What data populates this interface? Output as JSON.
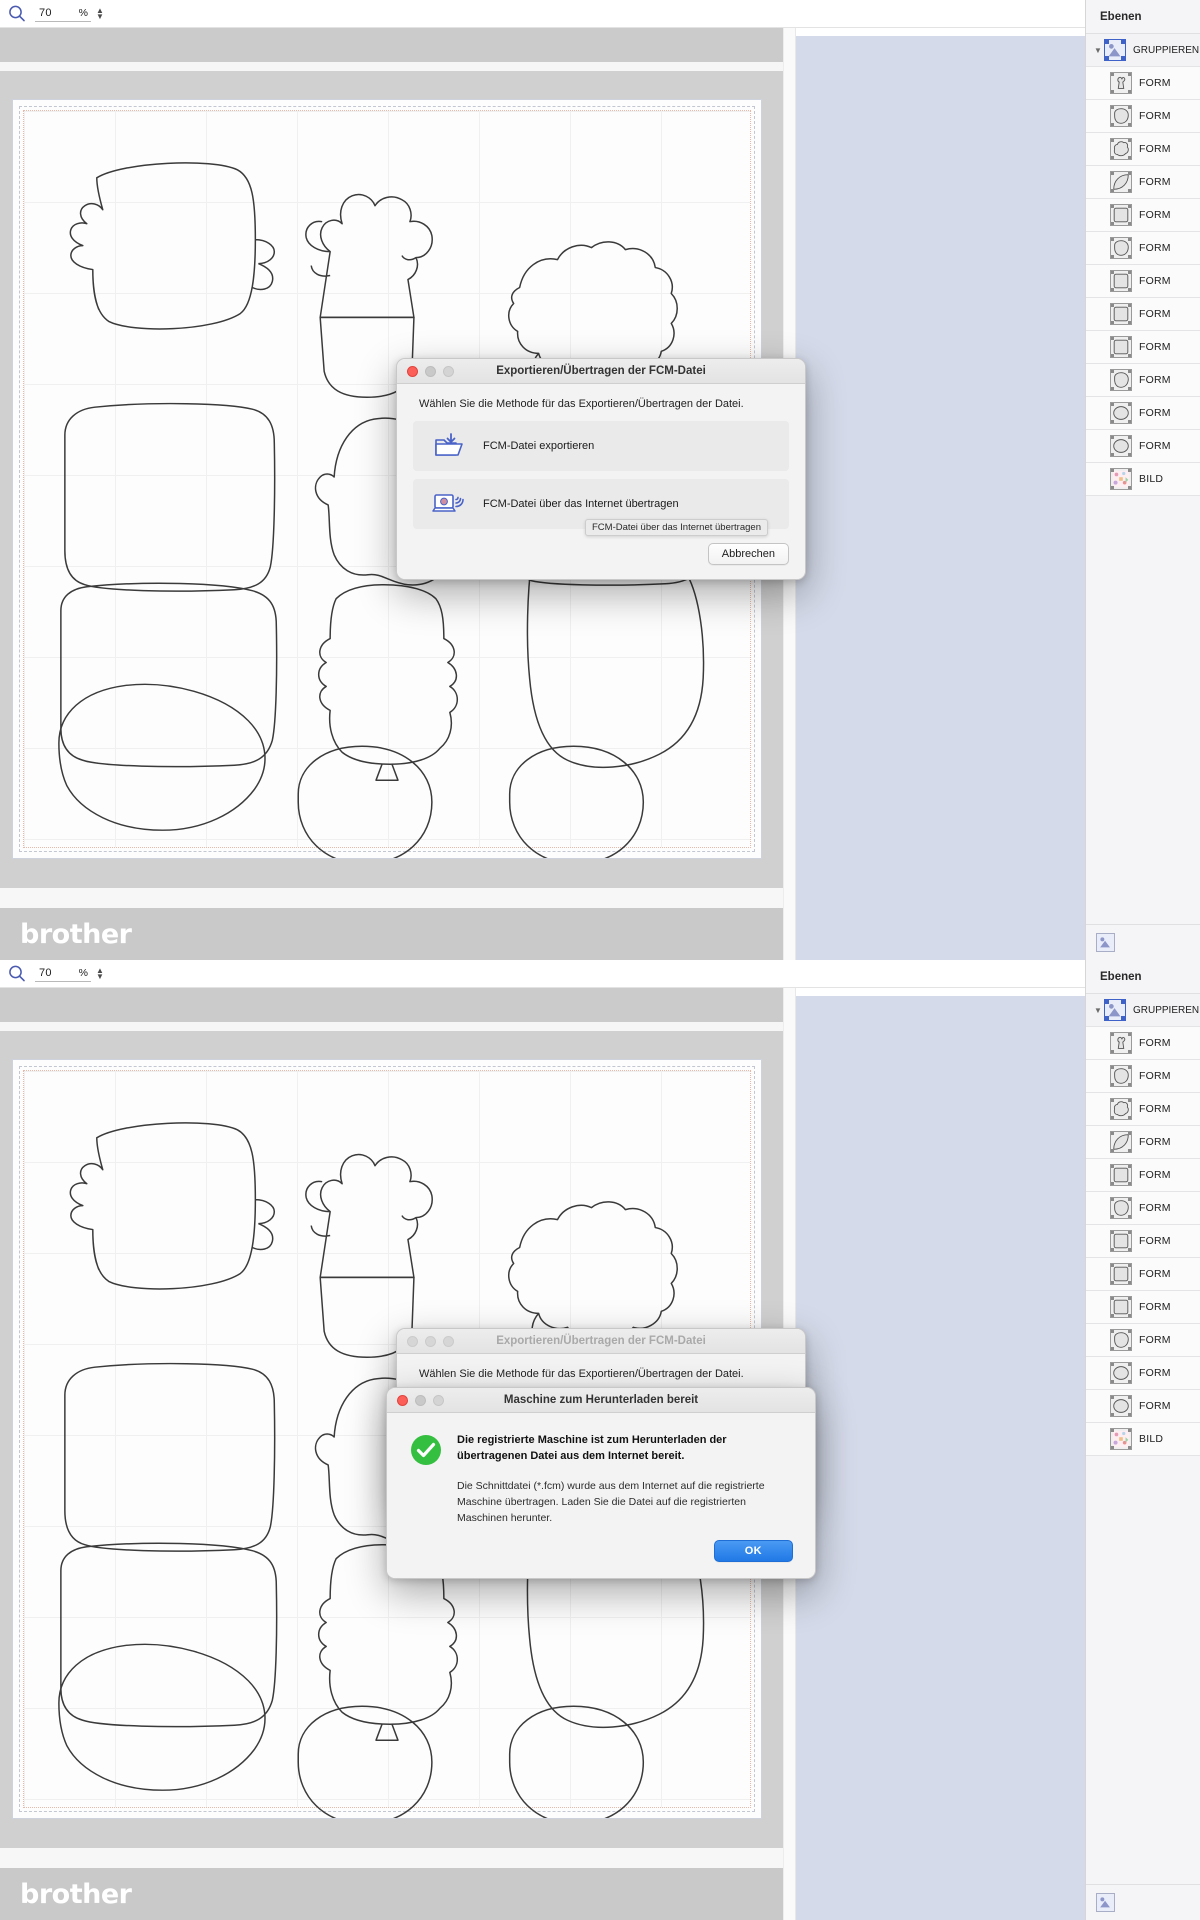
{
  "app": {
    "brand": "brother"
  },
  "toolbar": {
    "zoom_icon": "magnifier-icon",
    "zoom_value": "70",
    "zoom_unit": "%"
  },
  "layers_panel": {
    "header": "Ebenen",
    "group": {
      "label": "GRUPPIEREN",
      "disclosure": "▼",
      "icon": "group-thumbnail-icon"
    },
    "items_top": [
      {
        "label": "FORM",
        "shape": "cactus"
      },
      {
        "label": "FORM",
        "shape": "blob-round"
      },
      {
        "label": "FORM",
        "shape": "bush"
      },
      {
        "label": "FORM",
        "shape": "leaf"
      },
      {
        "label": "FORM",
        "shape": "square"
      },
      {
        "label": "FORM",
        "shape": "blob-round"
      },
      {
        "label": "FORM",
        "shape": "square"
      },
      {
        "label": "FORM",
        "shape": "square"
      },
      {
        "label": "FORM",
        "shape": "square"
      },
      {
        "label": "FORM",
        "shape": "blob-round"
      },
      {
        "label": "FORM",
        "shape": "circle"
      },
      {
        "label": "FORM",
        "shape": "circle"
      },
      {
        "label": "BILD",
        "shape": "image"
      }
    ],
    "items_bottom": [
      {
        "label": "FORM",
        "shape": "cactus"
      },
      {
        "label": "FORM",
        "shape": "blob-round"
      },
      {
        "label": "FORM",
        "shape": "bush"
      },
      {
        "label": "FORM",
        "shape": "leaf"
      },
      {
        "label": "FORM",
        "shape": "square"
      },
      {
        "label": "FORM",
        "shape": "blob-round"
      },
      {
        "label": "FORM",
        "shape": "square"
      },
      {
        "label": "FORM",
        "shape": "square"
      },
      {
        "label": "FORM",
        "shape": "square"
      },
      {
        "label": "FORM",
        "shape": "blob-round"
      },
      {
        "label": "FORM",
        "shape": "circle"
      },
      {
        "label": "FORM",
        "shape": "circle"
      },
      {
        "label": "BILD",
        "shape": "image"
      }
    ],
    "footer_icon": "add-layer-icon"
  },
  "export_dialog": {
    "title": "Exportieren/Übertragen der FCM-Datei",
    "prompt": "Wählen Sie die Methode für das Exportieren/Übertragen der Datei.",
    "option_export": {
      "label": "FCM-Datei exportieren",
      "icon": "folder-download-icon"
    },
    "option_transfer": {
      "label": "FCM-Datei über das Internet übertragen",
      "icon": "laptop-wireless-icon"
    },
    "tooltip": "FCM-Datei über das Internet übertragen",
    "cancel_label": "Abbrechen"
  },
  "alert_dialog": {
    "title": "Maschine zum Herunterladen bereit",
    "icon": "success-check-icon",
    "headline": "Die registrierte Maschine ist zum Herunterladen der übertragenen Datei aus dem Internet bereit.",
    "body": "Die Schnittdatei (*.fcm) wurde aus dem Internet auf die registrierte Maschine übertragen. Laden Sie die Datei auf die registrierten Maschinen herunter.",
    "ok_label": "OK"
  },
  "colors": {
    "accent_blue": "#2179e6",
    "success_green": "#35bf41",
    "pane_blue": "#d4dae9",
    "mat_gray": "#d0d0d0",
    "brand_band": "#c9c9c9",
    "icon_blue": "#4a63c8"
  }
}
